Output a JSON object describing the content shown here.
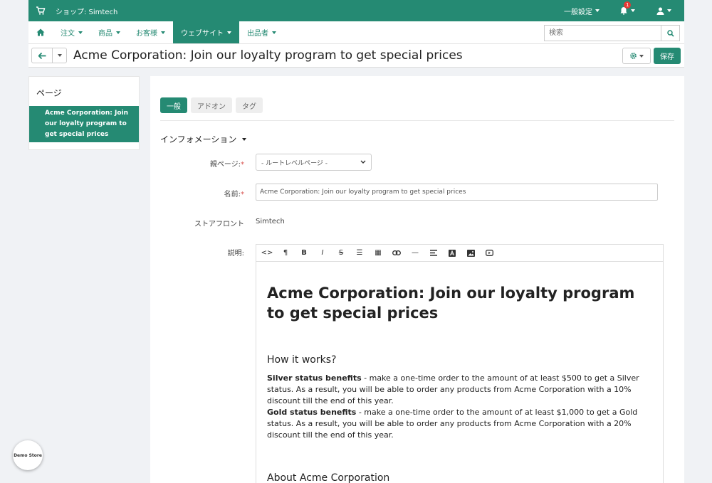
{
  "topbar": {
    "shop": "ショップ: Simtech",
    "settings": "一般設定",
    "notification_count": "1"
  },
  "nav": {
    "items": [
      "注文",
      "商品",
      "お客様",
      "ウェブサイト",
      "出品者"
    ],
    "active_index": 3,
    "search_placeholder": "検索"
  },
  "title": {
    "text": "Acme Corporation: Join our loyalty program to get special prices",
    "save": "保存"
  },
  "sidebar": {
    "heading": "ページ",
    "active_item": "Acme Corporation: Join our loyalty program to get special prices"
  },
  "tabs": [
    "一般",
    "アドオン",
    "タグ"
  ],
  "section": "インフォメーション",
  "form": {
    "parent_label": "親ページ:",
    "parent_value": "- ルートレベルページ -",
    "name_label": "名前:",
    "name_value": "Acme Corporation: Join our loyalty program to get special prices",
    "storefront_label": "ストアフロント",
    "storefront_value": "Simtech",
    "description_label": "説明:"
  },
  "editor": {
    "heading": "Acme Corporation: Join our loyalty program to get special prices",
    "how": "How it works?",
    "silver_bold": "Silver status benefits",
    "silver_text": " - make a one-time order to the amount of at least $500 to get a Silver status. As a result, you will be able to order any products from Acme Corporation with a 10% discount till the end of this year.",
    "gold_bold": "Gold status benefits",
    "gold_text": " - make a one-time order to the amount of at least $1,000 to get a Gold status. As a result, you will be able to order any products from Acme Corporation with a 20% discount till the end of this year.",
    "about": "About Acme Corporation"
  },
  "demo": "Demo Store",
  "colors": {
    "accent": "#258a73",
    "badge": "#e53935"
  }
}
